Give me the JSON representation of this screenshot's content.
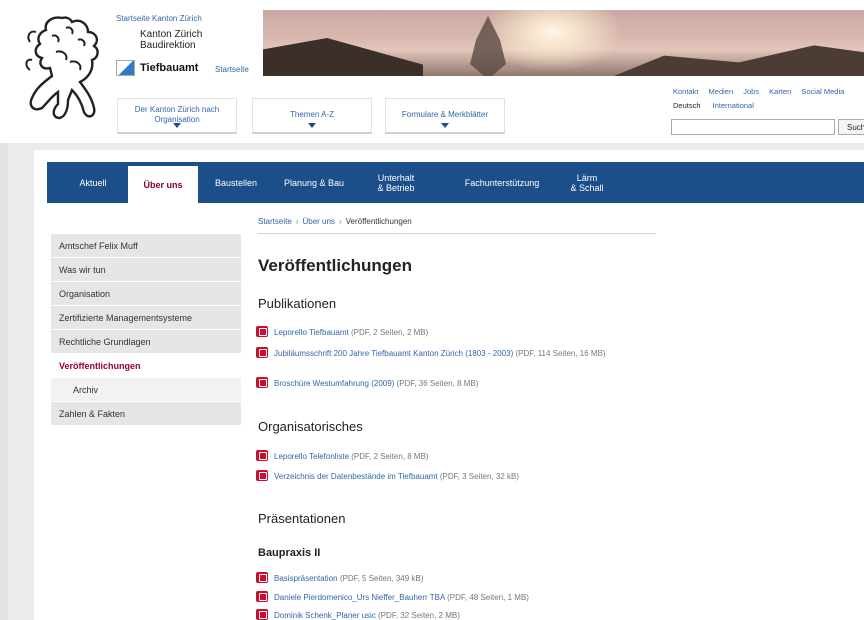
{
  "header": {
    "home_kanton": "Startseite Kanton Zürich",
    "dept_line1": "Kanton Zürich",
    "dept_line2": "Baudirektion",
    "dept_name": "Tiefbauamt",
    "dept_home": "Startseite",
    "dropdowns": [
      {
        "line1": "Der Kanton Zürich nach",
        "line2": "Organisation"
      },
      {
        "line1": "Themen A-Z",
        "line2": ""
      },
      {
        "line1": "Formulare & Merkblätter",
        "line2": ""
      }
    ],
    "service_links": [
      "Kontakt",
      "Medien",
      "Jobs",
      "Karten",
      "Social Media"
    ],
    "lang_current": "Deutsch",
    "lang_international": "International",
    "search_placeholder": "",
    "search_button": "Such"
  },
  "nav": [
    {
      "line1": "Aktuell",
      "line2": ""
    },
    {
      "line1": "Über uns",
      "line2": ""
    },
    {
      "line1": "Baustellen",
      "line2": ""
    },
    {
      "line1": "Planung & Bau",
      "line2": ""
    },
    {
      "line1": "Unterhalt",
      "line2": "& Betrieb"
    },
    {
      "line1": "Fachunterstützung",
      "line2": ""
    },
    {
      "line1": "Lärm",
      "line2": "& Schall"
    }
  ],
  "breadcrumb": {
    "home": "Startseite",
    "parent": "Über uns",
    "current": "Veröffentlichungen"
  },
  "sidebar": [
    "Amtschef Felix Muff",
    "Was wir tun",
    "Organisation",
    "Zertifizierte Managementsysteme",
    "Rechtliche Grundlagen",
    "Veröffentlichungen",
    "Archiv",
    "Zahlen & Fakten"
  ],
  "main": {
    "title": "Veröffentlichungen",
    "sections": [
      {
        "heading": "Publikationen",
        "docs": [
          {
            "link": "Leporello Tiefbauamt",
            "meta": " (PDF, 2 Seiten, 2 MB)"
          },
          {
            "link": "Jubiläumsschrift 200 Jahre Tiefbauamt Kanton Zürich (1803 - 2003)",
            "meta": " (PDF, 114 Seiten, 16 MB)"
          },
          {
            "link": "Broschüre Westumfahrung (2009)",
            "meta": " (PDF, 36 Seiten, 8 MB)"
          }
        ]
      },
      {
        "heading": "Organisatorisches",
        "docs": [
          {
            "link": "Leporello Telefonliste",
            "meta": " (PDF, 2 Seiten, 8 MB)"
          },
          {
            "link": "Verzeichnis der Datenbestände im Tiefbauamt",
            "meta": " (PDF, 3 Seiten, 32 kB)"
          }
        ]
      },
      {
        "heading": "Präsentationen",
        "subheading": "Baupraxis II",
        "docs": [
          {
            "link": "Basispräsentation",
            "meta": " (PDF, 5 Seiten, 349 kB)"
          },
          {
            "link": "Daniele Pierdomenico_Urs Nieffer_Bauherr TBA",
            "meta": " (PDF, 48 Seiten, 1 MB)"
          },
          {
            "link": "Dominik Schenk_Planer usic",
            "meta": " (PDF, 32 Seiten, 2 MB)"
          }
        ]
      }
    ]
  }
}
